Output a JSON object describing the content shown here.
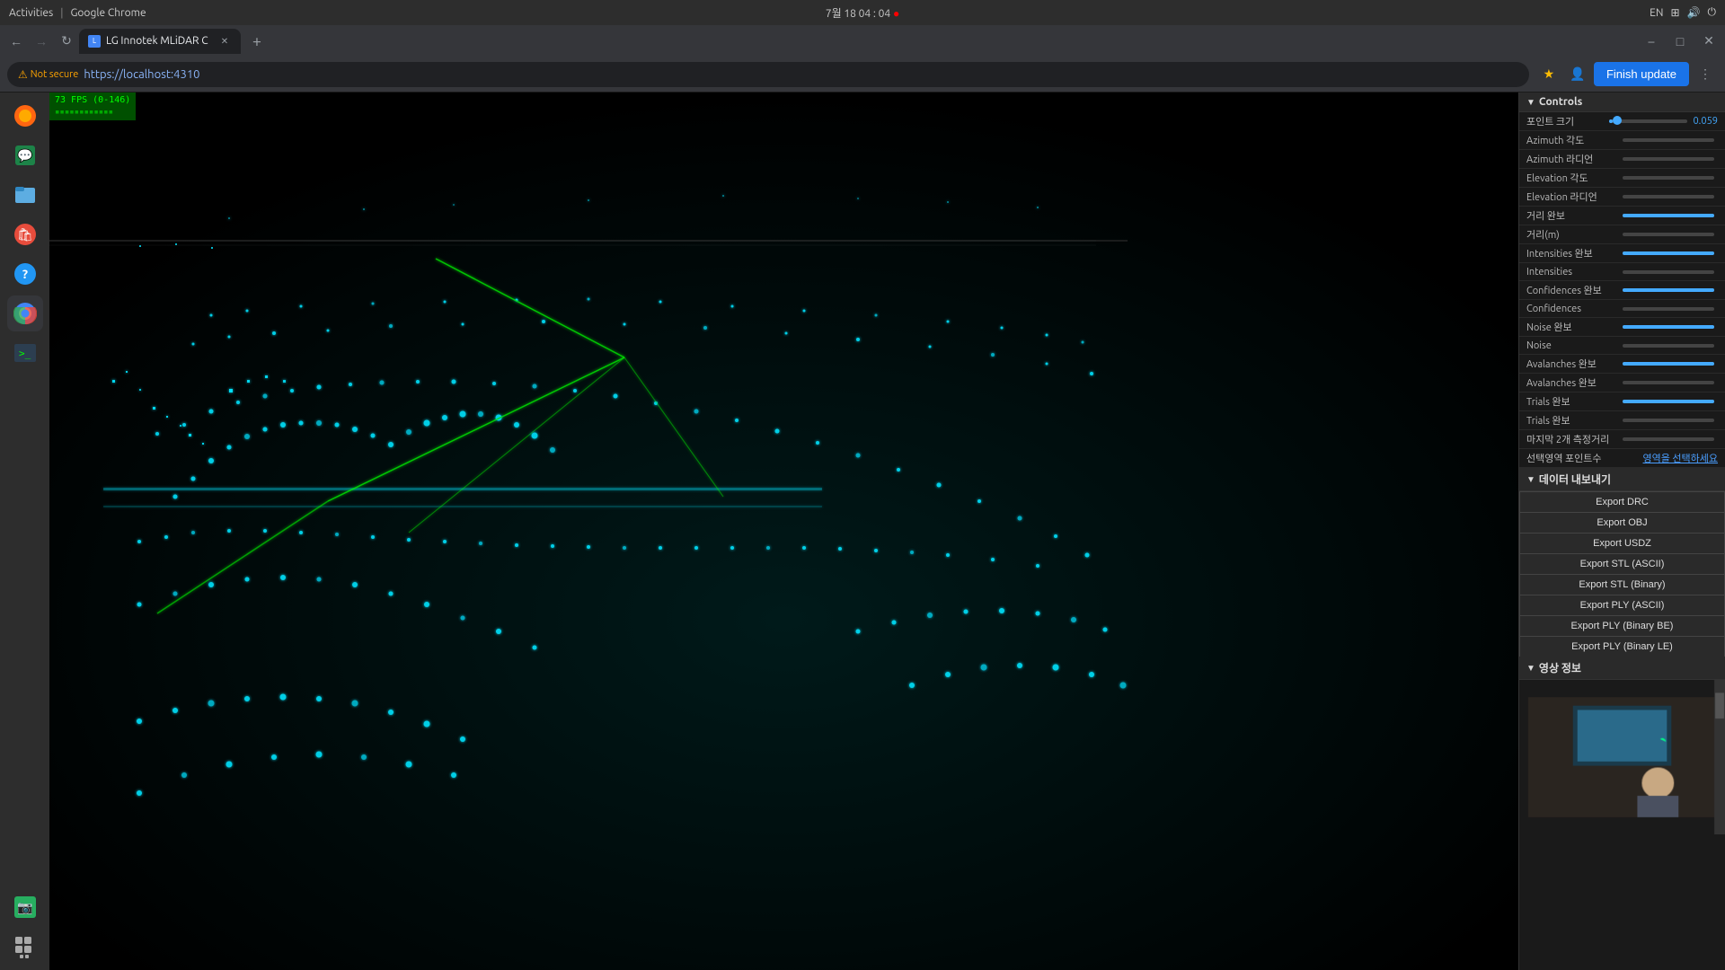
{
  "os": {
    "topbar": {
      "activities": "Activities",
      "browser": "Google Chrome",
      "datetime": "7월 18  04 : 04",
      "recording_dot": "●",
      "lang": "EN"
    },
    "apps": [
      {
        "name": "firefox",
        "icon": "🦊",
        "label": "Firefox"
      },
      {
        "name": "files",
        "icon": "📁",
        "label": "Files"
      },
      {
        "name": "ubuntu-software",
        "icon": "🛍",
        "label": "Ubuntu Software"
      },
      {
        "name": "help",
        "icon": "❓",
        "label": "Help"
      },
      {
        "name": "chrome",
        "icon": "🌐",
        "label": "Chrome"
      },
      {
        "name": "terminal",
        "icon": "⬛",
        "label": "Terminal"
      },
      {
        "name": "screenshot",
        "icon": "📷",
        "label": "Screenshot"
      },
      {
        "name": "apps-grid",
        "icon": "⊞",
        "label": "Show Applications"
      }
    ]
  },
  "browser": {
    "tab": {
      "title": "LG Innotek MLiDAR C",
      "url": "https://localhost:4310"
    },
    "security": "Not secure",
    "finish_update": "Finish update",
    "chevron": "›"
  },
  "fps": {
    "value": "73 FPS (0-146)",
    "sub": "▪▪▪▪▪▪▪▪▪▪▪▪"
  },
  "controls": {
    "section_title": "Controls",
    "rows": [
      {
        "label": "포인트 크기",
        "has_slider": true,
        "value": "0.059"
      },
      {
        "label": "Azimuth 각도",
        "has_slider": true,
        "value": ""
      },
      {
        "label": "Azimuth 라디언",
        "has_slider": true,
        "value": ""
      },
      {
        "label": "Elevation 각도",
        "has_slider": true,
        "value": ""
      },
      {
        "label": "Elevation 라디언",
        "has_slider": true,
        "value": ""
      },
      {
        "label": "거리 완보",
        "has_slider": true,
        "value": ""
      },
      {
        "label": "거리(m)",
        "has_slider": true,
        "value": ""
      },
      {
        "label": "Intensities 완보",
        "has_slider": true,
        "value": ""
      },
      {
        "label": "Intensities",
        "has_slider": true,
        "value": ""
      },
      {
        "label": "Confidences 완보",
        "has_slider": true,
        "value": ""
      },
      {
        "label": "Confidences",
        "has_slider": true,
        "value": ""
      },
      {
        "label": "Noise 완보",
        "has_slider": true,
        "value": ""
      },
      {
        "label": "Noise",
        "has_slider": true,
        "value": ""
      },
      {
        "label": "Avalanches 완보",
        "has_slider": true,
        "value": ""
      },
      {
        "label": "Avalanches 완보",
        "has_slider": true,
        "value": ""
      },
      {
        "label": "Trials 완보",
        "has_slider": true,
        "value": ""
      },
      {
        "label": "Trials 완보",
        "has_slider": true,
        "value": ""
      },
      {
        "label": "마지막 2개 측정거리",
        "has_slider": true,
        "value": ""
      }
    ],
    "selected_area": {
      "label": "선택영역 포인트수",
      "link": "영역을 선택하세요"
    }
  },
  "export": {
    "section_title": "데이터 내보내기",
    "buttons": [
      "Export DRC",
      "Export OBJ",
      "Export USDZ",
      "Export STL (ASCII)",
      "Export STL (Binary)",
      "Export PLY (ASCII)",
      "Export PLY (Binary BE)",
      "Export PLY (Binary LE)"
    ]
  },
  "video_section": {
    "title": "영상 정보"
  },
  "colors": {
    "accent": "#4ab4ff",
    "background": "#000000",
    "panel_bg": "#1a1a1a",
    "point_cloud": "#00e5ff"
  }
}
